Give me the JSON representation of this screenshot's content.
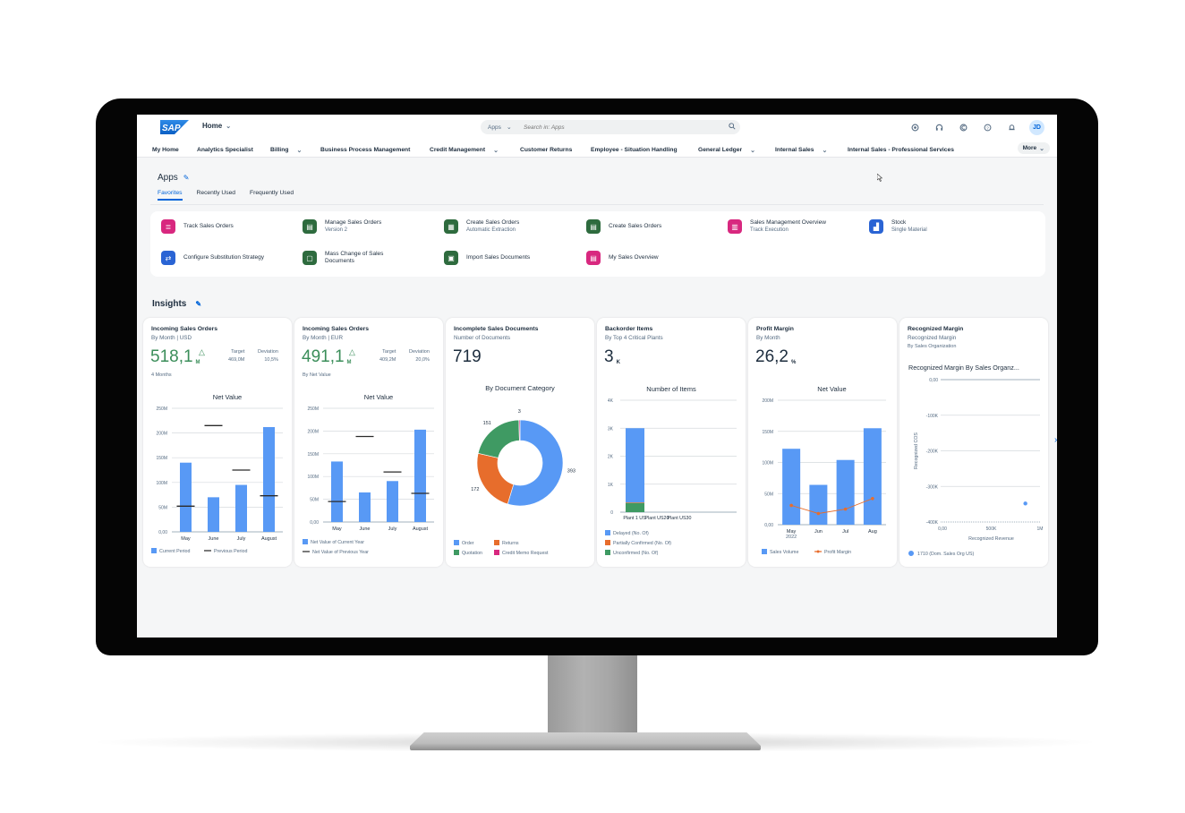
{
  "shell": {
    "logo_text": "SAP",
    "home_label": "Home",
    "search_scope": "Apps",
    "search_placeholder": "Search in: Apps",
    "avatar_initials": "JD",
    "more_label": "More",
    "header_icons": [
      "joule-icon",
      "support-headset-icon",
      "copilot-icon",
      "help-icon",
      "notification-bell-icon"
    ]
  },
  "nav": {
    "items": [
      {
        "label": "My Home",
        "active": true,
        "dropdown": false
      },
      {
        "label": "Analytics Specialist",
        "active": false,
        "dropdown": false
      },
      {
        "label": "Billing",
        "active": false,
        "dropdown": true
      },
      {
        "label": "Business Process Management",
        "active": false,
        "dropdown": false
      },
      {
        "label": "Credit Management",
        "active": false,
        "dropdown": true
      },
      {
        "label": "Customer Returns",
        "active": false,
        "dropdown": false
      },
      {
        "label": "Employee - Situation Handling",
        "active": false,
        "dropdown": false
      },
      {
        "label": "General Ledger",
        "active": false,
        "dropdown": true
      },
      {
        "label": "Internal Sales",
        "active": false,
        "dropdown": true
      },
      {
        "label": "Internal Sales - Professional Services",
        "active": false,
        "dropdown": false
      }
    ]
  },
  "apps": {
    "title": "Apps",
    "tabs": [
      {
        "label": "Favorites",
        "active": true
      },
      {
        "label": "Recently Used",
        "active": false
      },
      {
        "label": "Frequently Used",
        "active": false
      }
    ],
    "tiles": [
      {
        "name": "Track Sales Orders",
        "sub": "",
        "color": "#d8287f",
        "icon": "track-orders-icon",
        "glyph": "≣"
      },
      {
        "name": "Manage Sales Orders",
        "sub": "Version 2",
        "color": "#2e6b3e",
        "icon": "manage-orders-icon",
        "glyph": "▤"
      },
      {
        "name": "Create Sales Orders",
        "sub": "Automatic Extraction",
        "color": "#2e6b3e",
        "icon": "pdf-extraction-icon",
        "glyph": "▦"
      },
      {
        "name": "Create Sales Orders",
        "sub": "",
        "color": "#2e6b3e",
        "icon": "create-orders-icon",
        "glyph": "▤"
      },
      {
        "name": "Sales Management Overview",
        "sub": "Track Execution",
        "color": "#d8287f",
        "icon": "overview-icon",
        "glyph": "▥"
      },
      {
        "name": "Stock",
        "sub": "Single Material",
        "color": "#2a64d4",
        "icon": "stock-chart-icon",
        "glyph": "▟"
      },
      {
        "name": "Configure Substitution Strategy",
        "sub": "",
        "color": "#2a64d4",
        "icon": "substitution-icon",
        "glyph": "⇄"
      },
      {
        "name": "Mass Change of Sales Documents",
        "sub": "",
        "color": "#2e6b3e",
        "icon": "mass-change-icon",
        "glyph": "▢"
      },
      {
        "name": "Import Sales Documents",
        "sub": "",
        "color": "#2e6b3e",
        "icon": "import-documents-icon",
        "glyph": "▣"
      },
      {
        "name": "My Sales Overview",
        "sub": "",
        "color": "#d8287f",
        "icon": "my-sales-icon",
        "glyph": "▤"
      }
    ]
  },
  "insights": {
    "title": "Insights",
    "cards": [
      {
        "title": "Incoming Sales Orders",
        "subtitle": "By Month | USD",
        "kpi": "518,1",
        "kpi_unit": "M",
        "trend": "up",
        "target_label": "Target",
        "target_value": "469,0M",
        "deviation_label": "Deviation",
        "deviation_value": "10,5%",
        "note": "4 Months"
      },
      {
        "title": "Incoming Sales Orders",
        "subtitle": "By Month | EUR",
        "kpi": "491,1",
        "kpi_unit": "M",
        "trend": "up",
        "target_label": "Target",
        "target_value": "409,2M",
        "deviation_label": "Deviation",
        "deviation_value": "20,0%",
        "note": "By Net Value"
      },
      {
        "title": "Incomplete Sales Documents",
        "subtitle": "Number of Documents",
        "kpi": "719",
        "kpi_unit": ""
      },
      {
        "title": "Backorder Items",
        "subtitle": "By Top 4 Critical Plants",
        "kpi": "3",
        "kpi_unit": "K"
      },
      {
        "title": "Profit Margin",
        "subtitle": "By Month",
        "kpi": "26,2",
        "kpi_unit": "%"
      },
      {
        "title": "Recognized Margin",
        "subtitle": "Recognized Margin",
        "subtitle2": "By Sales Organization"
      }
    ]
  },
  "colors": {
    "brand_blue": "#0064d9",
    "bar_blue": "#5899f5",
    "orange": "#e76d2c",
    "green": "#3f9a63",
    "pink": "#d8287f",
    "kpi_green": "#3b8e5a"
  },
  "chart_data": [
    {
      "type": "bar",
      "title": "Net Value",
      "categories": [
        "May",
        "June",
        "July",
        "August"
      ],
      "series": [
        {
          "name": "Current Period",
          "kind": "bar",
          "values": [
            140,
            70,
            95,
            212
          ]
        },
        {
          "name": "Previous Period",
          "kind": "marker",
          "values": [
            52,
            215,
            125,
            73
          ]
        }
      ],
      "yticks": [
        "0,00",
        "50M",
        "100M",
        "150M",
        "200M",
        "250M"
      ],
      "ylim": [
        0,
        250
      ],
      "yunit": "M"
    },
    {
      "type": "bar",
      "title": "Net Value",
      "categories": [
        "May",
        "June",
        "July",
        "August"
      ],
      "series": [
        {
          "name": "Net Value of Current Year",
          "kind": "bar",
          "values": [
            133,
            65,
            90,
            203
          ]
        },
        {
          "name": "Net Value of Previous Year",
          "kind": "marker",
          "values": [
            45,
            188,
            110,
            63
          ]
        }
      ],
      "yticks": [
        "0,00",
        "50M",
        "100M",
        "150M",
        "200M",
        "250M"
      ],
      "ylim": [
        0,
        250
      ],
      "yunit": "M"
    },
    {
      "type": "pie",
      "title": "By Document Category",
      "donut": true,
      "slices": [
        {
          "label": "Order",
          "value": 393,
          "color": "#5899f5"
        },
        {
          "label": "Returns",
          "value": 172,
          "color": "#e76d2c"
        },
        {
          "label": "Quotation",
          "value": 151,
          "color": "#3f9a63"
        },
        {
          "label": "Credit Memo Request",
          "value": 3,
          "color": "#d8287f"
        }
      ]
    },
    {
      "type": "bar",
      "stacked": true,
      "title": "Number of Items",
      "categories": [
        "Plant 1 US",
        "Plant US20",
        "Plant US30"
      ],
      "series": [
        {
          "name": "Unconfirmed (No. Of)",
          "values": [
            330,
            0,
            0
          ],
          "color": "#3f9a63"
        },
        {
          "name": "Partially Confirmed (No. Of)",
          "values": [
            20,
            0,
            0
          ],
          "color": "#e76d2c"
        },
        {
          "name": "Delayed (No. Of)",
          "values": [
            2650,
            0,
            0
          ],
          "color": "#5899f5"
        }
      ],
      "yticks": [
        "0",
        "1K",
        "2K",
        "3K",
        "4K"
      ],
      "ylim": [
        0,
        4000
      ]
    },
    {
      "type": "bar",
      "title": "Net Value",
      "categories": [
        "May",
        "Jun",
        "Jul",
        "Aug"
      ],
      "category_sublabel": "2022",
      "series": [
        {
          "name": "Sales Volume",
          "kind": "bar",
          "values": [
            122,
            64,
            104,
            155
          ]
        },
        {
          "name": "Profit Margin",
          "kind": "line",
          "values": [
            31,
            18,
            25,
            42
          ]
        }
      ],
      "yticks": [
        "0,00",
        "50M",
        "100M",
        "150M",
        "200M"
      ],
      "ylim": [
        0,
        200
      ],
      "yunit": "M"
    },
    {
      "type": "scatter",
      "title": "Recognized Margin By Sales Organz...",
      "xlabel": "Recognized Revenue",
      "ylabel": "Recognized COS",
      "xticks": [
        "0,00",
        "500K",
        "1M"
      ],
      "yticks": [
        "0,00",
        "-100K",
        "-200K",
        "-300K",
        "-400K"
      ],
      "xlim": [
        0,
        1000000
      ],
      "ylim": [
        -400000,
        0
      ],
      "points": [
        {
          "label": "1710 (Dom. Sales Org US)",
          "x": 850000,
          "y": -348000
        }
      ]
    }
  ]
}
